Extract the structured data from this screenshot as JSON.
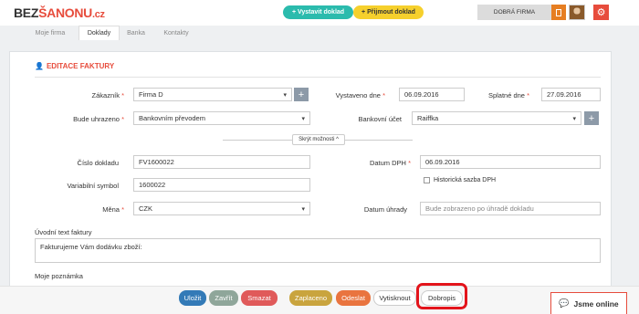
{
  "logo": {
    "a": "BEZ",
    "b": "ŠANONU",
    "c": ".cz"
  },
  "topbar": {
    "create_doc": "+ Vystavit doklad",
    "receive_doc": "+ Přijmout doklad",
    "firm": "DOBRÁ FIRMA"
  },
  "tabs": [
    "Moje firma",
    "Doklady",
    "Banka",
    "Kontakty"
  ],
  "form": {
    "title": "EDITACE FAKTURY",
    "customer_label": "Zákazník",
    "customer_value": "Firma D",
    "issued_label": "Vystaveno dne",
    "issued_value": "06.09.2016",
    "due_label": "Splatné dne",
    "due_value": "27.09.2016",
    "paid_by_label": "Bude uhrazeno",
    "paid_by_value": "Bankovním převodem",
    "bank_label": "Bankovní účet",
    "bank_value": "Raiffka",
    "toggle_label": "Skrýt možnosti ^",
    "doc_no_label": "Číslo dokladu",
    "doc_no_value": "FV1600022",
    "vat_date_label": "Datum DPH",
    "vat_date_value": "06.09.2016",
    "historic_vat_label": "Historická sazba DPH",
    "var_symbol_label": "Variabilní symbol",
    "var_symbol_value": "1600022",
    "currency_label": "Měna",
    "currency_value": "CZK",
    "pay_date_label": "Datum úhrady",
    "pay_date_placeholder": "Bude zobrazeno po úhradě dokladu",
    "intro_label": "Úvodní text faktury",
    "intro_value": "Fakturujeme Vám dodávku zboží:",
    "note_label": "Moje poznámka"
  },
  "actions": {
    "save": "Uložit",
    "close": "Zavřít",
    "delete": "Smazat",
    "paid": "Zaplaceno",
    "send": "Odeslat",
    "print": "Vytisknout",
    "credit_note": "Dobropis"
  },
  "chat": {
    "label": "Jsme online"
  },
  "colors": {
    "accent": "#e74c3c",
    "teal": "#2bbbad",
    "yellow": "#f6d02c",
    "highlight": "#e3141b"
  }
}
